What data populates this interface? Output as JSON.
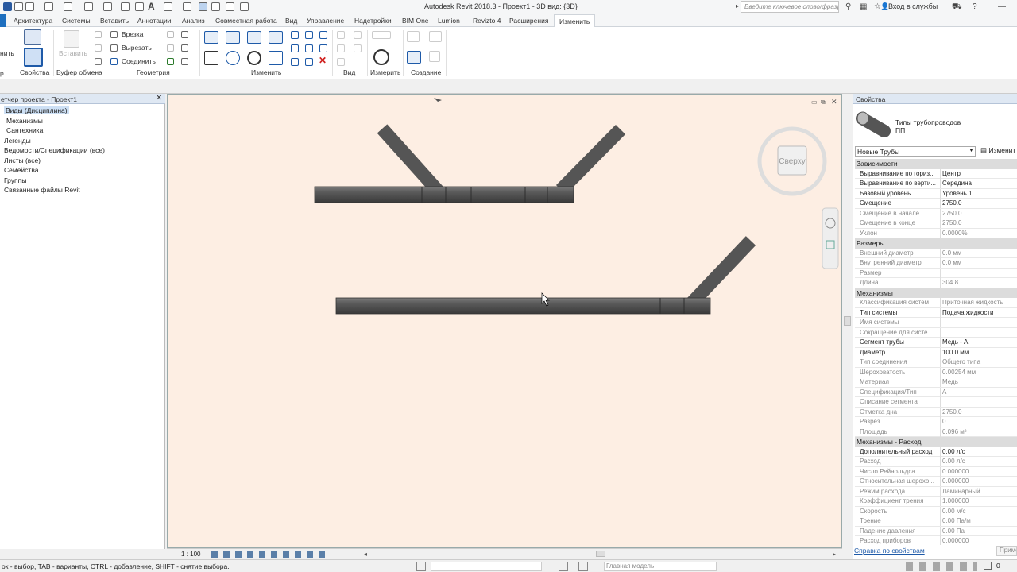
{
  "app_title": "Autodesk Revit 2018.3 -    Проект1 - 3D вид: {3D}",
  "search_placeholder": "Введите ключевое слово/фразу",
  "login_label": "Вход в службы",
  "tabs": [
    "Архитектура",
    "Системы",
    "Вставить",
    "Аннотации",
    "Анализ",
    "Совместная работа",
    "Вид",
    "Управление",
    "Надстройки",
    "BIM One",
    "Lumion",
    "Revizto 4",
    "Расширения",
    "Изменить"
  ],
  "active_tab": "Изменить",
  "ribbon": {
    "groups": [
      "Свойства",
      "Буфер обмена",
      "Геометрия",
      "Изменить",
      "Вид",
      "Измерить",
      "Создание"
    ],
    "edge_label": "нить",
    "edge_group": "р",
    "paste_label": "Вставить",
    "geom": {
      "cut": "Врезка",
      "cutout": "Вырезать",
      "join": "Соединить"
    }
  },
  "browser": {
    "title": "етчер проекта - Проект1",
    "items": [
      "Виды (Дисциплина)",
      "Механизмы",
      "Сантехника",
      "Легенды",
      "Ведомости/Спецификации (все)",
      "Листы (все)",
      "Семейства",
      "Группы",
      "Связанные файлы Revit"
    ]
  },
  "viewcube_label": "Сверху",
  "view_scale": "1 : 100",
  "properties": {
    "title": "Свойства",
    "type_name": "Типы трубопроводов",
    "type_sub": "ПП",
    "selector": "Новые Трубы",
    "edit_type": "Изменит",
    "sections": [
      {
        "name": "Зависимости",
        "rows": [
          [
            "Выравнивание по гориз...",
            "Центр",
            0
          ],
          [
            "Выравнивание по верти...",
            "Середина",
            0
          ],
          [
            "Базовый уровень",
            "Уровень 1",
            0
          ],
          [
            "Смещение",
            "2750.0",
            0
          ],
          [
            "Смещение в начале",
            "2750.0",
            1
          ],
          [
            "Смещение в конце",
            "2750.0",
            1
          ],
          [
            "Уклон",
            "0.0000%",
            1
          ]
        ]
      },
      {
        "name": "Размеры",
        "rows": [
          [
            "Внешний диаметр",
            "0.0 мм",
            1
          ],
          [
            "Внутренний диаметр",
            "0.0 мм",
            1
          ],
          [
            "Размер",
            "",
            1
          ],
          [
            "Длина",
            "304.8",
            1
          ]
        ]
      },
      {
        "name": "Механизмы",
        "rows": [
          [
            "Классификация систем",
            "Приточная жидкость",
            1
          ],
          [
            "Тип системы",
            "Подача жидкости",
            0
          ],
          [
            "Имя системы",
            "",
            1
          ],
          [
            "Сокращение для систе...",
            "",
            1
          ],
          [
            "Сегмент трубы",
            "Медь - А",
            0
          ],
          [
            "Диаметр",
            "100.0 мм",
            0
          ],
          [
            "Тип соединения",
            "Общего типа",
            1
          ],
          [
            "Шероховатость",
            "0.00254 мм",
            1
          ],
          [
            "Материал",
            "Медь",
            1
          ],
          [
            "Спецификация/Тип",
            "A",
            1
          ],
          [
            "Описание сегмента",
            "",
            1
          ],
          [
            "Отметка дна",
            "2750.0",
            1
          ],
          [
            "Разрез",
            "0",
            1
          ],
          [
            "Площадь",
            "0.096 м²",
            1
          ]
        ]
      },
      {
        "name": "Механизмы - Расход",
        "rows": [
          [
            "Дополнительный расход",
            "0.00 л/с",
            0
          ],
          [
            "Расход",
            "0.00 л/с",
            1
          ],
          [
            "Число Рейнольдса",
            "0.000000",
            1
          ],
          [
            "Относительная шерохо...",
            "0.000000",
            1
          ],
          [
            "Режим расхода",
            "Ламинарный",
            1
          ],
          [
            "Коэффициент трения",
            "1.000000",
            1
          ],
          [
            "Скорость",
            "0.00 м/с",
            1
          ],
          [
            "Трение",
            "0.00 Па/м",
            1
          ],
          [
            "Падение давления",
            "0.00 Па",
            1
          ],
          [
            "Расход приборов",
            "0.000000",
            1
          ]
        ]
      }
    ],
    "help_link": "Справка по свойствам",
    "apply_label": "Приме"
  },
  "status": {
    "text": "ок - выбор, TAB - варианты, CTRL - добавление, SHIFT - снятие выбора.",
    "model": "Главная модель",
    "filter_count": "0"
  }
}
